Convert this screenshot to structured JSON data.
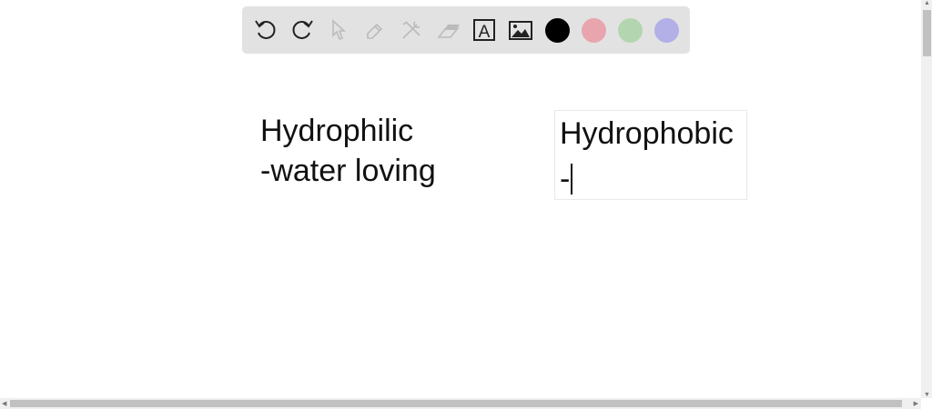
{
  "toolbar": {
    "tools": [
      {
        "name": "undo-icon"
      },
      {
        "name": "redo-icon"
      },
      {
        "name": "select-icon"
      },
      {
        "name": "pen-icon"
      },
      {
        "name": "tools-icon"
      },
      {
        "name": "eraser-icon"
      },
      {
        "name": "text-icon"
      },
      {
        "name": "image-icon"
      }
    ],
    "text_tool_glyph": "A",
    "colors": [
      "#000000",
      "#e8a5ae",
      "#b3d6b0",
      "#b3b0e8"
    ]
  },
  "canvas": {
    "left_text": {
      "line1": "Hydrophilic",
      "line2": "-water loving"
    },
    "right_text": {
      "line1": "Hydrophobic",
      "line2": "-"
    }
  }
}
